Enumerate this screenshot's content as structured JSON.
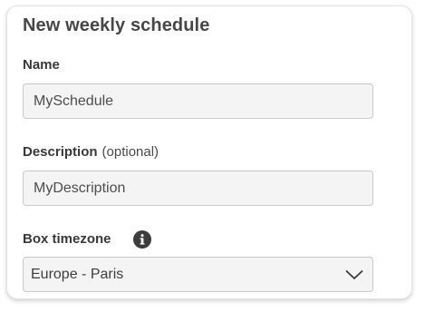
{
  "form": {
    "title": "New weekly schedule",
    "name": {
      "label": "Name",
      "value": "MySchedule"
    },
    "description": {
      "label": "Description",
      "optional_text": "(optional)",
      "value": "MyDescription"
    },
    "timezone": {
      "label": "Box timezone",
      "info_icon": "info-icon",
      "selected": "Europe - Paris",
      "dropdown_icon": "chevron-down-icon"
    }
  },
  "colors": {
    "field_background": "#f4f4f4",
    "field_border": "#c9c9c9",
    "title_text": "#474747",
    "label_text": "#383838"
  }
}
